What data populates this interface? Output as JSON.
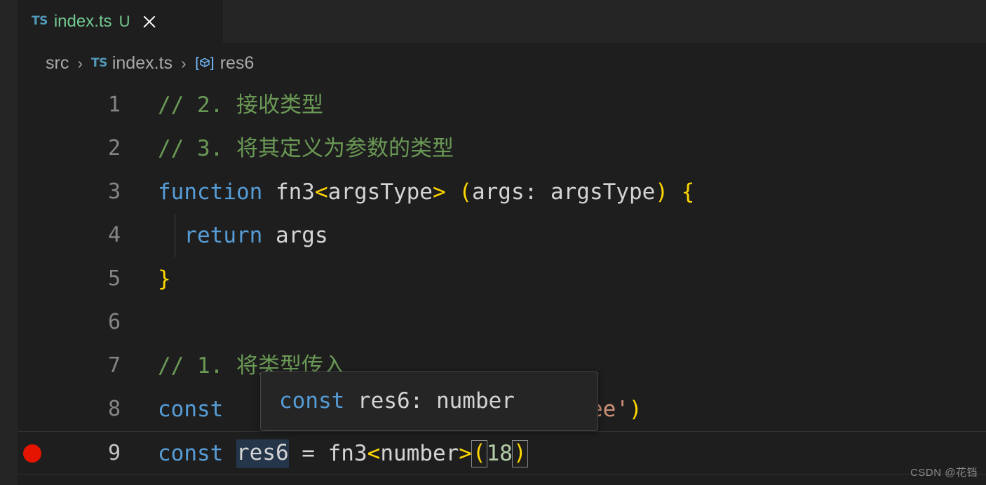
{
  "window": {
    "background_color": "#1e1e1e",
    "chrome_color": "#252526"
  },
  "tab": {
    "icon_label": "TS",
    "filename": "index.ts",
    "git_status": "U",
    "close_label": "×"
  },
  "breadcrumb": {
    "separator": "›",
    "items": [
      {
        "label": "src",
        "icon": "none"
      },
      {
        "label": "index.ts",
        "icon": "ts-file-icon"
      },
      {
        "label": "res6",
        "icon": "symbol-variable-icon"
      }
    ]
  },
  "editor": {
    "language": "typescript",
    "active_line": 9,
    "breakpoint_line": 9,
    "lines": [
      {
        "number": "1",
        "tokens": [
          {
            "text": "// 2. 接收类型",
            "kind": "comment"
          }
        ]
      },
      {
        "number": "2",
        "tokens": [
          {
            "text": "// 3. 将其定义为参数的类型",
            "kind": "comment"
          }
        ]
      },
      {
        "number": "3",
        "tokens": [
          {
            "text": "function ",
            "kind": "keyword"
          },
          {
            "text": "fn3",
            "kind": "ident"
          },
          {
            "text": "<",
            "kind": "punct-y"
          },
          {
            "text": "argsType",
            "kind": "ident"
          },
          {
            "text": ">",
            "kind": "punct-y"
          },
          {
            "text": " ",
            "kind": "plain"
          },
          {
            "text": "(",
            "kind": "punct-y"
          },
          {
            "text": "args: argsType",
            "kind": "ident"
          },
          {
            "text": ")",
            "kind": "punct-y"
          },
          {
            "text": " ",
            "kind": "plain"
          },
          {
            "text": "{",
            "kind": "punct-y"
          }
        ]
      },
      {
        "number": "4",
        "tokens": [
          {
            "text": "  ",
            "kind": "plain"
          },
          {
            "text": "return",
            "kind": "keyword"
          },
          {
            "text": " args",
            "kind": "ident"
          }
        ]
      },
      {
        "number": "5",
        "tokens": [
          {
            "text": "}",
            "kind": "punct-y"
          }
        ]
      },
      {
        "number": "6",
        "tokens": []
      },
      {
        "number": "7",
        "tokens": [
          {
            "text": "// 1. 将类型传入",
            "kind": "comment"
          }
        ]
      },
      {
        "number": "8",
        "tokens": [
          {
            "text": "const",
            "kind": "keyword"
          },
          {
            "text": "                           ",
            "kind": "plain"
          },
          {
            "text": "Lee'",
            "kind": "string"
          },
          {
            "text": ")",
            "kind": "punct-y"
          }
        ]
      },
      {
        "number": "9",
        "tokens": [
          {
            "text": "const ",
            "kind": "keyword"
          },
          {
            "text": "res6",
            "kind": "ident-highlight"
          },
          {
            "text": " = ",
            "kind": "plain"
          },
          {
            "text": "fn3",
            "kind": "ident"
          },
          {
            "text": "<",
            "kind": "punct-y"
          },
          {
            "text": "number",
            "kind": "ident"
          },
          {
            "text": ">",
            "kind": "punct-y"
          },
          {
            "text": "(",
            "kind": "punct-y-box"
          },
          {
            "text": "18",
            "kind": "number"
          },
          {
            "text": ")",
            "kind": "punct-y-box"
          }
        ]
      }
    ]
  },
  "tooltip": {
    "visible": true,
    "keyword": "const",
    "rest": " res6: number"
  },
  "watermark": {
    "text": "CSDN @花铛"
  },
  "colors": {
    "comment": "#6a9955",
    "keyword": "#569cd6",
    "plain": "#d4d4d4",
    "punctuation_yellow": "#ffd700",
    "string": "#ce9178",
    "number": "#b5cea8",
    "breakpoint_red": "#e51400",
    "tab_git_untracked": "#73c991",
    "ts_icon_blue": "#519aba",
    "word_highlight": "#26364a"
  }
}
